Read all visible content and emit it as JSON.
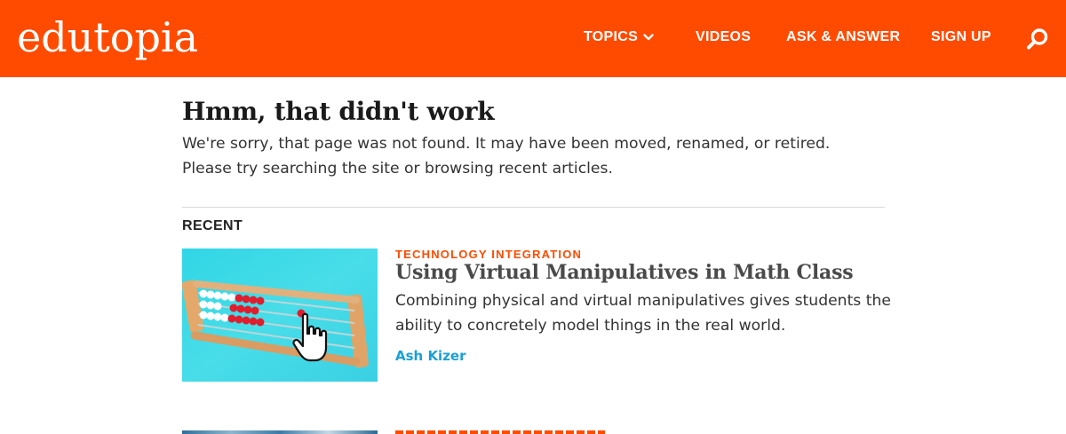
{
  "header": {
    "logo": "edutopia",
    "nav": [
      {
        "label": "TOPICS",
        "has_dropdown": true
      },
      {
        "label": "VIDEOS"
      },
      {
        "label": "ASK & ANSWER"
      },
      {
        "label": "SIGN UP"
      }
    ],
    "search_icon": "search-icon",
    "brand_color": "#ff4b00"
  },
  "error": {
    "title": "Hmm, that didn't work",
    "message": "We're sorry, that page was not found. It may have been moved, renamed, or retired. Please try searching the site or browsing recent articles."
  },
  "recent": {
    "label": "RECENT",
    "articles": [
      {
        "category": "TECHNOLOGY INTEGRATION",
        "title": "Using Virtual Manipulatives in Math Class",
        "description": "Combining physical and virtual manipulatives gives students the ability to concretely model things in the real world.",
        "author": "Ash Kizer",
        "image": "abacus-with-pointer-cursor"
      }
    ]
  },
  "colors": {
    "accent": "#ff4b00",
    "author_link": "#1aa0d6"
  }
}
